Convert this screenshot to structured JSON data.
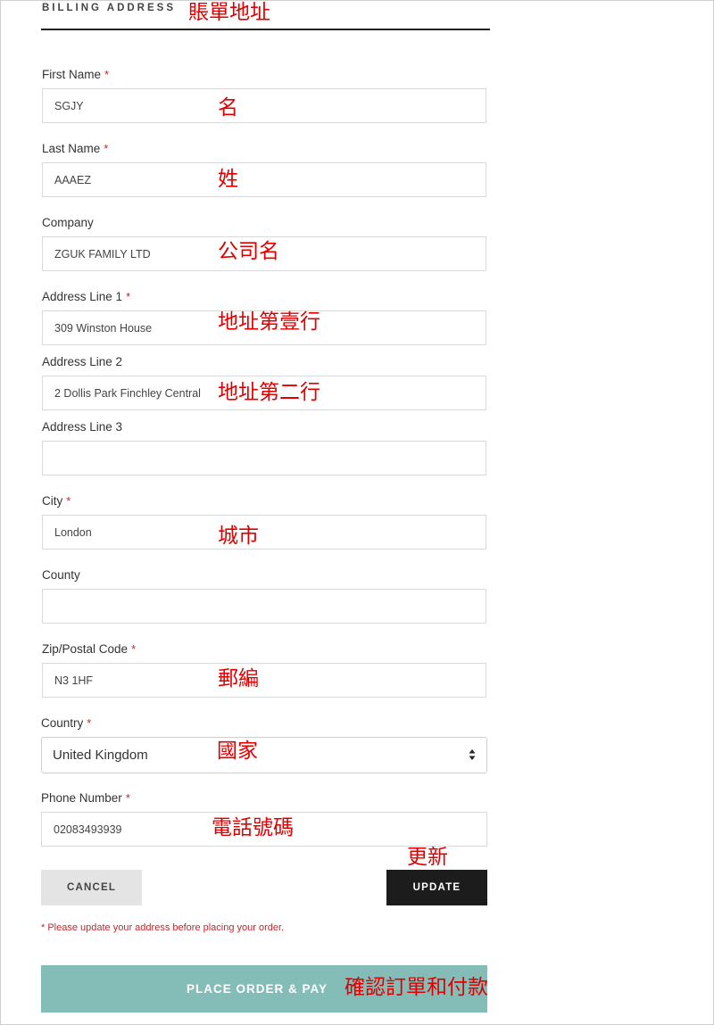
{
  "section": {
    "title": "BILLING ADDRESS",
    "annotation": "賬單地址"
  },
  "required_mark": "*",
  "fields": {
    "first_name": {
      "label": "First Name",
      "value": "SGJY",
      "annotation": "名"
    },
    "last_name": {
      "label": "Last Name",
      "value": "AAAEZ",
      "annotation": "姓"
    },
    "company": {
      "label": "Company",
      "value": "ZGUK FAMILY LTD",
      "annotation": "公司名"
    },
    "address1": {
      "label": "Address Line 1",
      "value": "309 Winston House",
      "annotation": "地址第壹行"
    },
    "address2": {
      "label": "Address Line 2",
      "value": "2 Dollis Park Finchley Central",
      "annotation": "地址第二行"
    },
    "address3": {
      "label": "Address Line 3",
      "value": ""
    },
    "city": {
      "label": "City",
      "value": "London",
      "annotation": "城市"
    },
    "county": {
      "label": "County",
      "value": ""
    },
    "zip": {
      "label": "Zip/Postal Code",
      "value": "N3 1HF",
      "annotation": "郵編"
    },
    "country": {
      "label": "Country",
      "value": "United Kingdom",
      "annotation": "國家"
    },
    "phone": {
      "label": "Phone Number",
      "value": "02083493939",
      "annotation": "電話號碼"
    }
  },
  "buttons": {
    "cancel": "CANCEL",
    "update": "UPDATE",
    "update_annotation": "更新",
    "place_order": "PLACE ORDER & PAY",
    "place_order_annotation": "確認訂單和付款"
  },
  "notice": "* Please update your address before placing your order.",
  "colors": {
    "required": "#c0282d",
    "annotation": "#e00000",
    "place_order_bg": "#84bcb7",
    "update_bg": "#1c1c1c",
    "cancel_bg": "#e4e4e4"
  }
}
